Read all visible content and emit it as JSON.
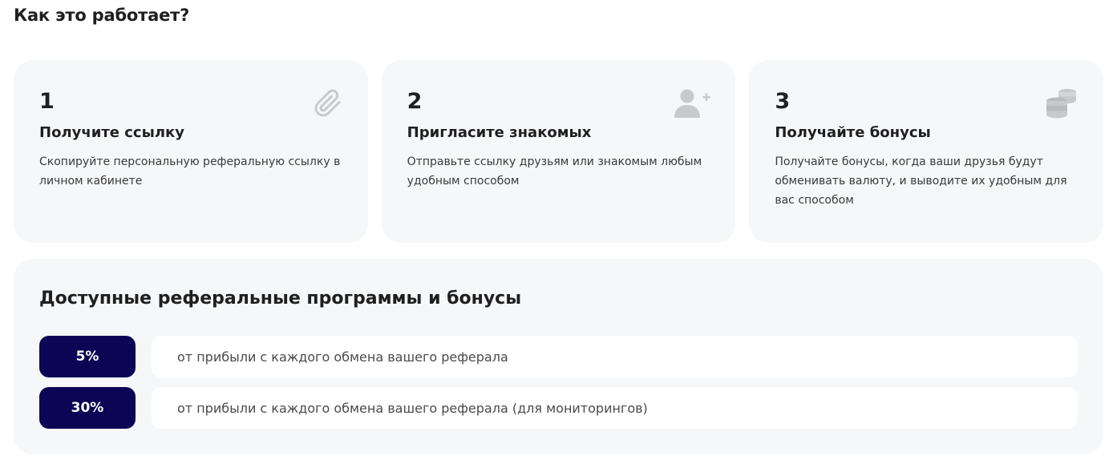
{
  "page": {
    "title": "Как это работает?"
  },
  "steps": [
    {
      "number": "1",
      "title": "Получите ссылку",
      "text": "Скопируйте персональную реферальную ссылку в личном кабинете",
      "icon": "paperclip-icon"
    },
    {
      "number": "2",
      "title": "Пригласите знакомых",
      "text": "Отправьте ссылку друзьям или знакомым любым удобным способом",
      "icon": "add-user-icon"
    },
    {
      "number": "3",
      "title": "Получайте бонусы",
      "text": "Получайте бонусы, когда ваши друзья будут обменивать валюту, и выводите их удобным для вас способом",
      "icon": "coins-icon"
    }
  ],
  "programs": {
    "title": "Доступные реферальные программы и бонусы",
    "items": [
      {
        "percent": "5%",
        "description": "от прибыли с каждого обмена вашего реферала"
      },
      {
        "percent": "30%",
        "description": "от прибыли с каждого обмена вашего реферала (для мониторингов)"
      }
    ]
  },
  "colors": {
    "badge_bg": "#0b0554",
    "card_bg": "#f6f7f9",
    "icon_gray": "#c8c9cc"
  }
}
